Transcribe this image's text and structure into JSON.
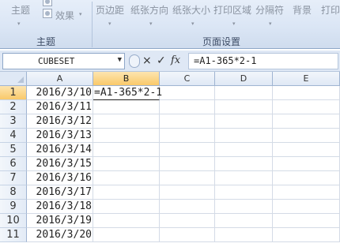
{
  "ribbon": {
    "theme_label": "主题",
    "effects_label": "效果",
    "margins_label": "页边距",
    "orientation_label": "纸张方向",
    "size_label": "纸张大小",
    "print_area_label": "打印区域",
    "breaks_label": "分隔符",
    "background_label": "背景",
    "print_titles_label": "打印",
    "group_theme": "主题",
    "group_page_setup": "页面设置"
  },
  "formula_bar": {
    "name_box_value": "CUBESET",
    "cancel_icon": "×",
    "enter_icon": "✓",
    "fx_label": "fx",
    "formula_value": "=A1-365*2-1"
  },
  "grid": {
    "columns": [
      "A",
      "B",
      "C",
      "D",
      "E"
    ],
    "rows": [
      "1",
      "2",
      "3",
      "4",
      "5",
      "6",
      "7",
      "8",
      "9",
      "10",
      "11"
    ],
    "col_a_values": [
      "2016/3/10",
      "2016/3/11",
      "2016/3/12",
      "2016/3/13",
      "2016/3/14",
      "2016/3/15",
      "2016/3/16",
      "2016/3/17",
      "2016/3/18",
      "2016/3/19",
      "2016/3/20"
    ],
    "b1_value": "=A1-365*2-1"
  }
}
